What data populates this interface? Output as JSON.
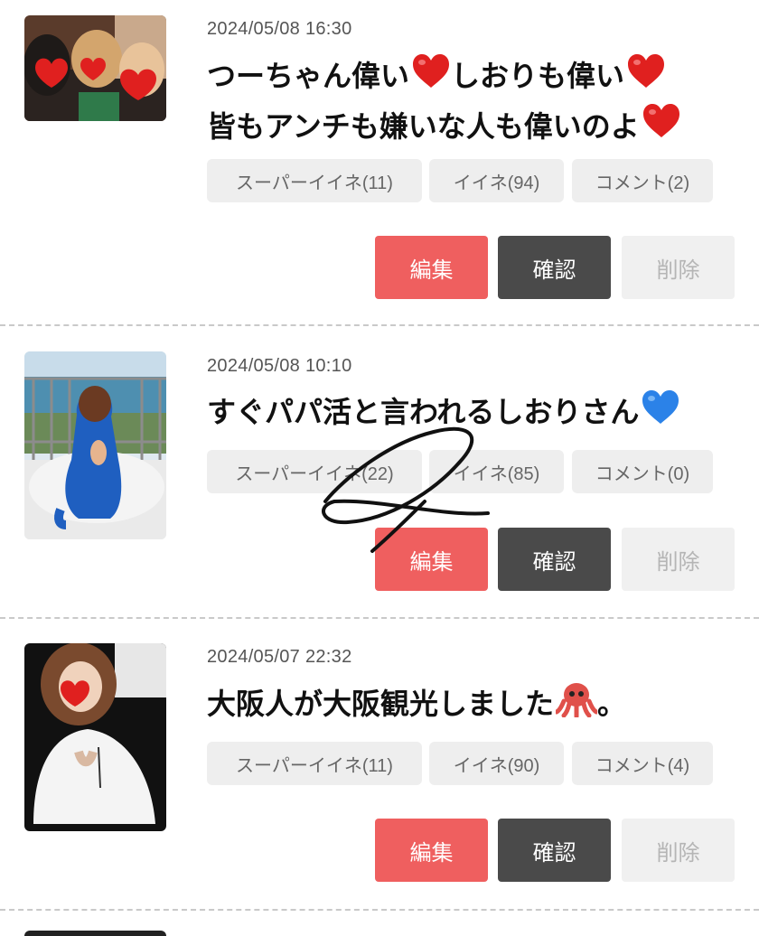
{
  "posts": [
    {
      "date": "2024/05/08 16:30",
      "title_line1_a": "つーちゃん偉い",
      "title_line1_b": "しおりも偉い",
      "title_line2": "皆もアンチも嫌いな人も偉いのよ",
      "emoji": "red-heart",
      "super_like": "スーパーイイネ(11)",
      "like": "イイネ(94)",
      "comment": "コメント(2)",
      "edit": "編集",
      "confirm": "確認",
      "delete": "削除"
    },
    {
      "date": "2024/05/08 10:10",
      "title": "すぐパパ活と言われるしおりさん",
      "emoji": "blue-heart",
      "super_like": "スーパーイイネ(22)",
      "like": "イイネ(85)",
      "comment": "コメント(0)",
      "edit": "編集",
      "confirm": "確認",
      "delete": "削除"
    },
    {
      "date": "2024/05/07 22:32",
      "title_a": "大阪人が大阪観光しました",
      "title_b": "。",
      "emoji": "octopus",
      "super_like": "スーパーイイネ(11)",
      "like": "イイネ(90)",
      "comment": "コメント(4)",
      "edit": "編集",
      "confirm": "確認",
      "delete": "削除"
    }
  ],
  "colors": {
    "edit_button": "#ef5f5f",
    "confirm_button": "#4a4a4a",
    "delete_button": "#f0f0f0",
    "pill_bg": "#eeeeee",
    "heart_red": "#e0201f",
    "heart_blue": "#2b82e8"
  }
}
